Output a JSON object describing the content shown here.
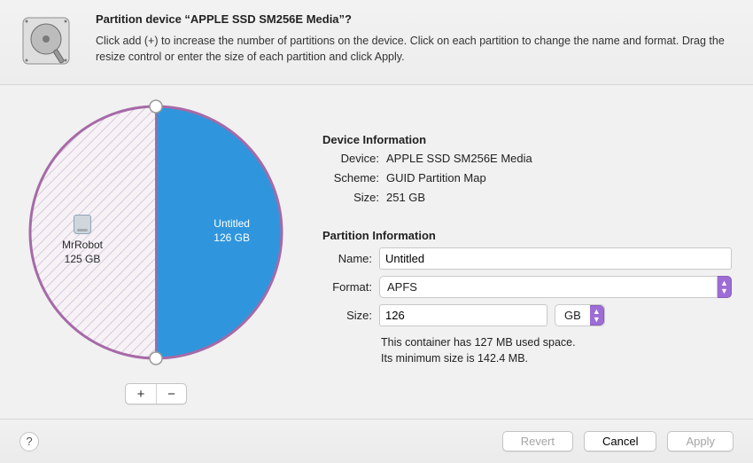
{
  "header": {
    "title": "Partition device “APPLE SSD SM256E Media”?",
    "subtitle": "Click add (+) to increase the number of partitions on the device. Click on each partition to change the name and format. Drag the resize control or enter the size of each partition and click Apply."
  },
  "chart_data": {
    "type": "pie",
    "title": "",
    "series": [
      {
        "name": "MrRobot",
        "value": 125,
        "unit": "GB",
        "color": "#f6f2f6",
        "selected": false
      },
      {
        "name": "Untitled",
        "value": 126,
        "unit": "GB",
        "color": "#2f96dd",
        "selected": true
      }
    ],
    "total": 251,
    "handle_count": 2
  },
  "partition_labels": {
    "left_name": "MrRobot",
    "left_size": "125 GB",
    "right_name": "Untitled",
    "right_size": "126 GB"
  },
  "toolbar": {
    "add_label": "+",
    "remove_label": "−"
  },
  "device_info": {
    "section_title": "Device Information",
    "device_label": "Device:",
    "device_value": "APPLE SSD SM256E Media",
    "scheme_label": "Scheme:",
    "scheme_value": "GUID Partition Map",
    "size_label": "Size:",
    "size_value": "251 GB"
  },
  "partition_info": {
    "section_title": "Partition Information",
    "name_label": "Name:",
    "name_value": "Untitled",
    "format_label": "Format:",
    "format_value": "APFS",
    "size_label": "Size:",
    "size_value": "126",
    "size_unit": "GB",
    "hint_line1": "This container has 127 MB used space.",
    "hint_line2": "Its minimum size is 142.4 MB."
  },
  "footer": {
    "help_label": "?",
    "revert_label": "Revert",
    "cancel_label": "Cancel",
    "apply_label": "Apply"
  }
}
